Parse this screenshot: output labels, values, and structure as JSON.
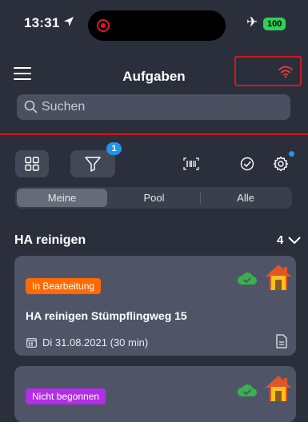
{
  "status_bar": {
    "time": "13:31",
    "battery": "100",
    "location_icon": "location-arrow-icon",
    "airplane_icon": "airplane-icon"
  },
  "header": {
    "title": "Aufgaben",
    "menu_icon": "hamburger-menu-icon",
    "wifi_icon": "wifi-icon",
    "wifi_color": "#e03b3b",
    "highlight_color": "#d01a1f"
  },
  "search": {
    "placeholder": "Suchen"
  },
  "toolbar": {
    "filter_badge": "1",
    "icons": [
      "grid-view-icon",
      "filter-icon",
      "barcode-scan-icon",
      "check-circle-icon",
      "settings-gear-icon"
    ]
  },
  "tabs": [
    {
      "label": "Meine",
      "active": true
    },
    {
      "label": "Pool",
      "active": false
    },
    {
      "label": "Alle",
      "active": false
    }
  ],
  "section": {
    "title": "HA reinigen",
    "count": "4"
  },
  "cards": [
    {
      "status": "In Bearbeitung",
      "status_color": "#ff6b00",
      "title": "HA reinigen Stümpflingweg 15",
      "date": "Di 31.08.2021 (30 min)",
      "sync_icon": "cloud-synced-icon",
      "house_icon": "house-icon"
    },
    {
      "status": "Nicht begonnen",
      "status_color": "#b22ee8",
      "sync_icon": "cloud-synced-icon",
      "house_icon": "house-icon"
    }
  ]
}
